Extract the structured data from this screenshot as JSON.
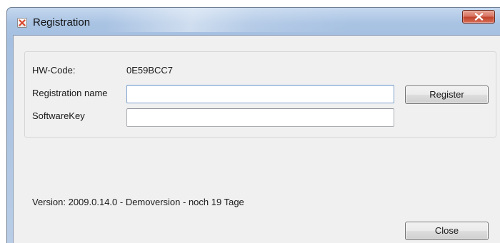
{
  "window": {
    "title": "Registration",
    "close_glyph": "X",
    "icon": "app-x-icon"
  },
  "form": {
    "hw_code_label": "HW-Code:",
    "hw_code_value": "0E59BCC7",
    "registration_name_label": "Registration name",
    "registration_name_value": "",
    "software_key_label": "SoftwareKey",
    "software_key_value": "",
    "register_label": "Register"
  },
  "status": {
    "version_text": "Version: 2009.0.14.0  -   Demoversion - noch 19 Tage"
  },
  "footer": {
    "close_label": "Close"
  },
  "colors": {
    "title_bar": "#a9c3e3",
    "close_button": "#c9503a",
    "client_bg": "#f0f0f0"
  }
}
